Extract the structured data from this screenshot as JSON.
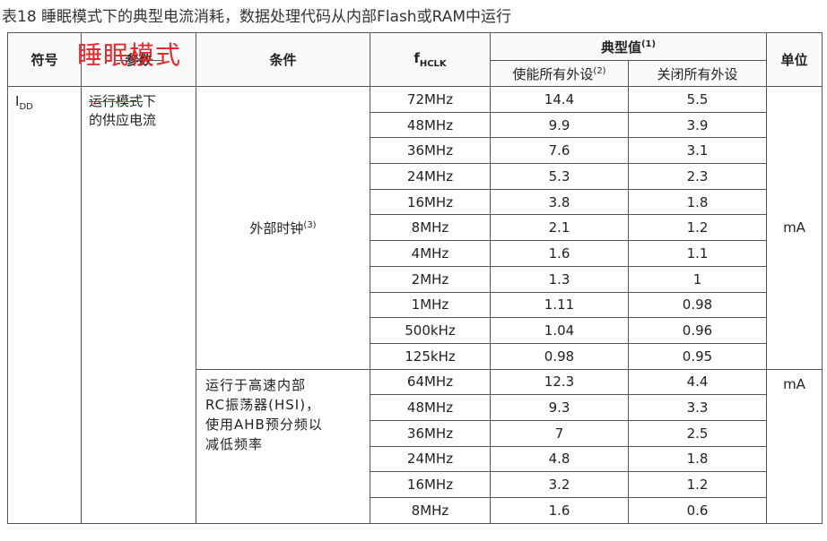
{
  "caption": "表18  睡眠模式下的典型电流消耗，数据处理代码从内部Flash或RAM中运行",
  "headers": {
    "symbol": "符号",
    "param": "参数",
    "condition": "条件",
    "fhclk_main": "f",
    "fhclk_sub": "HCLK",
    "typical": "典型值",
    "typical_sup": "(1)",
    "enable_all": "使能所有外设",
    "enable_sup": "(2)",
    "disable_all": "关闭所有外设",
    "unit": "单位"
  },
  "symbol_main": "I",
  "symbol_sub": "DD",
  "param_struck": "运行模式",
  "param_tail": "下",
  "param_line2": "的供应电流",
  "overlay_text": "睡眠模式",
  "cond1": "外部时钟",
  "cond1_sup": "(3)",
  "cond2_lines": [
    "运行于高速内部",
    "RC振荡器(HSI)，",
    "使用AHB预分频以",
    "减低频率"
  ],
  "unit1": "mA",
  "unit2": "mA",
  "rows1": [
    {
      "f": "72MHz",
      "en": "14.4",
      "dis": "5.5"
    },
    {
      "f": "48MHz",
      "en": "9.9",
      "dis": "3.9"
    },
    {
      "f": "36MHz",
      "en": "7.6",
      "dis": "3.1"
    },
    {
      "f": "24MHz",
      "en": "5.3",
      "dis": "2.3"
    },
    {
      "f": "16MHz",
      "en": "3.8",
      "dis": "1.8"
    },
    {
      "f": "8MHz",
      "en": "2.1",
      "dis": "1.2"
    },
    {
      "f": "4MHz",
      "en": "1.6",
      "dis": "1.1"
    },
    {
      "f": "2MHz",
      "en": "1.3",
      "dis": "1"
    },
    {
      "f": "1MHz",
      "en": "1.11",
      "dis": "0.98"
    },
    {
      "f": "500kHz",
      "en": "1.04",
      "dis": "0.96"
    },
    {
      "f": "125kHz",
      "en": "0.98",
      "dis": "0.95"
    }
  ],
  "rows2": [
    {
      "f": "64MHz",
      "en": "12.3",
      "dis": "4.4"
    },
    {
      "f": "48MHz",
      "en": "9.3",
      "dis": "3.3"
    },
    {
      "f": "36MHz",
      "en": "7",
      "dis": "2.5"
    },
    {
      "f": "24MHz",
      "en": "4.8",
      "dis": "1.8"
    },
    {
      "f": "16MHz",
      "en": "3.2",
      "dis": "1.2"
    },
    {
      "f": "8MHz",
      "en": "1.6",
      "dis": "0.6"
    }
  ]
}
